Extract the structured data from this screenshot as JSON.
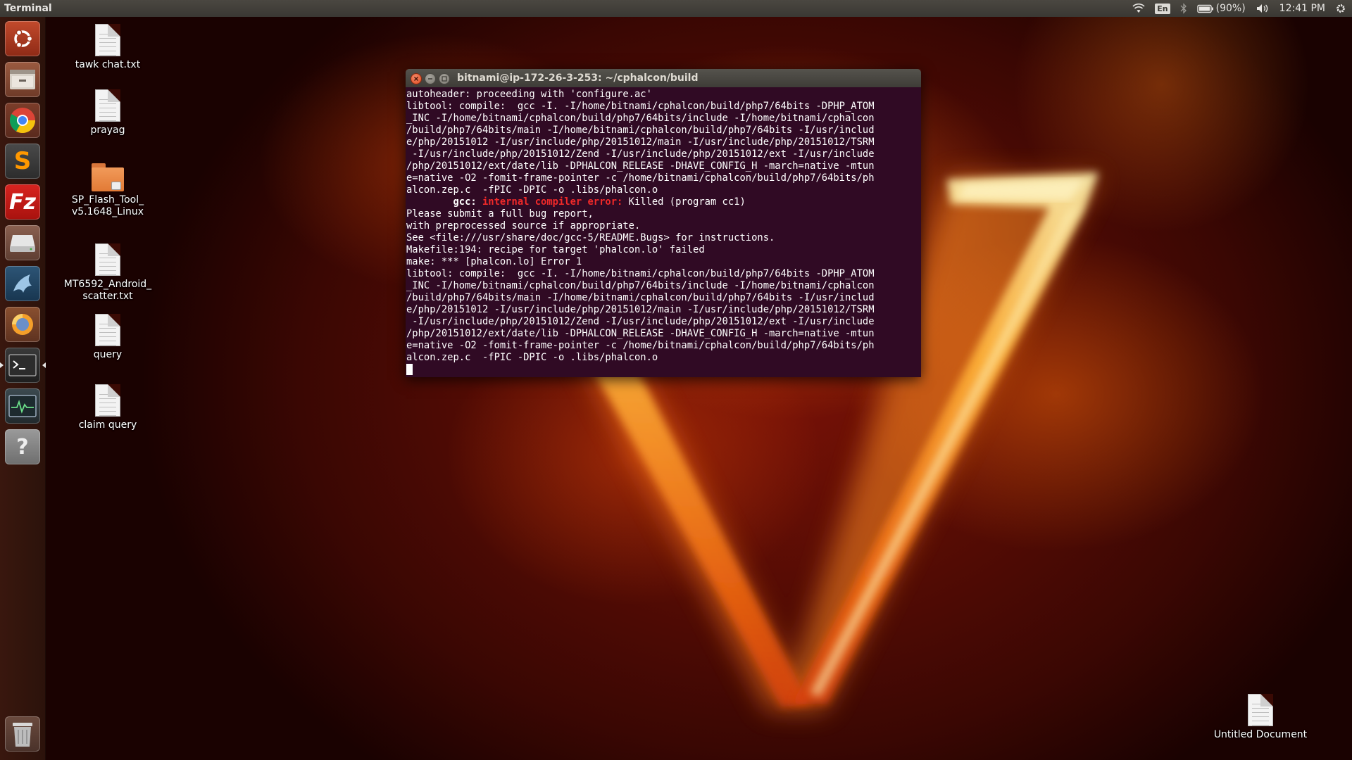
{
  "top_panel": {
    "app_title": "Terminal",
    "keyboard_layout": "En",
    "battery": "(90%)",
    "clock": "12:41 PM"
  },
  "launcher": {
    "items": [
      {
        "name": "ubuntu-dash",
        "icon": "ubuntu-logo-icon"
      },
      {
        "name": "files",
        "icon": "file-manager-icon"
      },
      {
        "name": "chrome",
        "icon": "chrome-icon"
      },
      {
        "name": "sublime-text",
        "icon": "sublime-text-icon"
      },
      {
        "name": "filezilla",
        "icon": "filezilla-icon"
      },
      {
        "name": "disks",
        "icon": "hard-drive-icon"
      },
      {
        "name": "mysql-workbench",
        "icon": "dolphin-icon"
      },
      {
        "name": "blender",
        "icon": "blender-icon"
      },
      {
        "name": "terminal",
        "icon": "terminal-icon"
      },
      {
        "name": "system-monitor",
        "icon": "system-monitor-icon"
      },
      {
        "name": "help",
        "icon": "help-icon"
      },
      {
        "name": "trash",
        "icon": "trash-icon"
      }
    ]
  },
  "desktop": {
    "icons": [
      {
        "label": "tawk chat.txt"
      },
      {
        "label": "prayag"
      },
      {
        "label": "SP_Flash_Tool_\nv5.1648_Linux"
      },
      {
        "label": "MT6592_Android_\nscatter.txt"
      },
      {
        "label": "query"
      },
      {
        "label": "claim query"
      },
      {
        "label": "Untitled Document"
      }
    ]
  },
  "terminal": {
    "title": "bitnami@ip-172-26-3-253: ~/cphalcon/build",
    "lines": [
      "autoheader: proceeding with 'configure.ac'",
      "libtool: compile:  gcc -I. -I/home/bitnami/cphalcon/build/php7/64bits -DPHP_ATOM",
      "_INC -I/home/bitnami/cphalcon/build/php7/64bits/include -I/home/bitnami/cphalcon",
      "/build/php7/64bits/main -I/home/bitnami/cphalcon/build/php7/64bits -I/usr/includ",
      "e/php/20151012 -I/usr/include/php/20151012/main -I/usr/include/php/20151012/TSRM",
      " -I/usr/include/php/20151012/Zend -I/usr/include/php/20151012/ext -I/usr/include",
      "/php/20151012/ext/date/lib -DPHALCON_RELEASE -DHAVE_CONFIG_H -march=native -mtun",
      "e=native -O2 -fomit-frame-pointer -c /home/bitnami/cphalcon/build/php7/64bits/ph",
      "alcon.zep.c  -fPIC -DPIC -o .libs/phalcon.o"
    ],
    "error_line": {
      "prefix": "        gcc: ",
      "error": "internal compiler error:",
      "rest": " Killed (program cc1)"
    },
    "lines_after": [
      "Please submit a full bug report,",
      "with preprocessed source if appropriate.",
      "See <file:///usr/share/doc/gcc-5/README.Bugs> for instructions.",
      "Makefile:194: recipe for target 'phalcon.lo' failed",
      "make: *** [phalcon.lo] Error 1",
      "libtool: compile:  gcc -I. -I/home/bitnami/cphalcon/build/php7/64bits -DPHP_ATOM",
      "_INC -I/home/bitnami/cphalcon/build/php7/64bits/include -I/home/bitnami/cphalcon",
      "/build/php7/64bits/main -I/home/bitnami/cphalcon/build/php7/64bits -I/usr/includ",
      "e/php/20151012 -I/usr/include/php/20151012/main -I/usr/include/php/20151012/TSRM",
      " -I/usr/include/php/20151012/Zend -I/usr/include/php/20151012/ext -I/usr/include",
      "/php/20151012/ext/date/lib -DPHALCON_RELEASE -DHAVE_CONFIG_H -march=native -mtun",
      "e=native -O2 -fomit-frame-pointer -c /home/bitnami/cphalcon/build/php7/64bits/ph",
      "alcon.zep.c  -fPIC -DPIC -o .libs/phalcon.o"
    ]
  }
}
